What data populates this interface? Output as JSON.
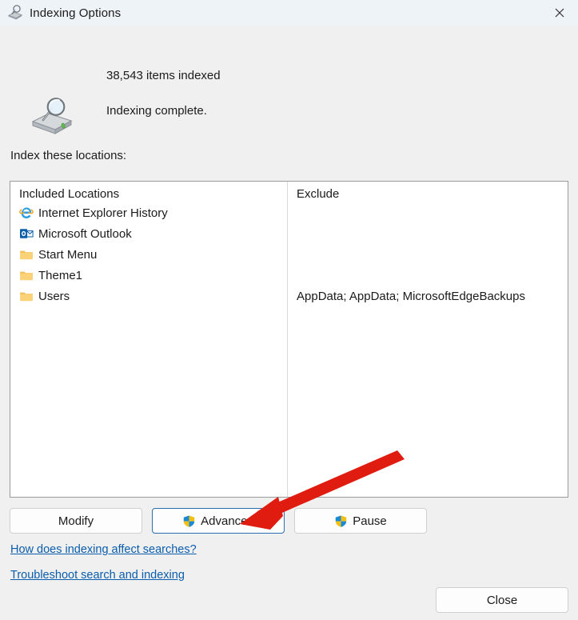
{
  "window": {
    "title": "Indexing Options",
    "title_icon": "indexing-search-icon",
    "close_icon": "close-icon"
  },
  "status": {
    "drive_icon": "drive-search-icon",
    "items_indexed": "38,543 items indexed",
    "indexing_state": "Indexing complete."
  },
  "locations": {
    "label": "Index these locations:",
    "included_header": "Included Locations",
    "exclude_header": "Exclude",
    "included": [
      {
        "label": "Internet Explorer History",
        "icon": "internet-explorer-icon",
        "exclude": ""
      },
      {
        "label": "Microsoft Outlook",
        "icon": "outlook-icon",
        "exclude": ""
      },
      {
        "label": "Start Menu",
        "icon": "folder-icon",
        "exclude": ""
      },
      {
        "label": "Theme1",
        "icon": "folder-icon",
        "exclude": ""
      },
      {
        "label": "Users",
        "icon": "folder-icon",
        "exclude": "AppData; AppData; MicrosoftEdgeBackups"
      }
    ]
  },
  "buttons": {
    "modify": "Modify",
    "advanced": "Advanced",
    "pause": "Pause",
    "close": "Close",
    "shield_icon": "uac-shield-icon",
    "focused": "advanced"
  },
  "links": {
    "affect_searches": "How does indexing affect searches?",
    "troubleshoot": "Troubleshoot search and indexing"
  },
  "annotation": {
    "type": "red-arrow",
    "color": "#e01b10",
    "points_to": "advanced-button"
  },
  "colors": {
    "window_background": "#f0f0f0",
    "titlebar_background": "#eef3f8",
    "listbox_background": "#ffffff",
    "link": "#0a5dac",
    "focus_border": "#2b6fae",
    "annotation_red": "#e01b10"
  }
}
